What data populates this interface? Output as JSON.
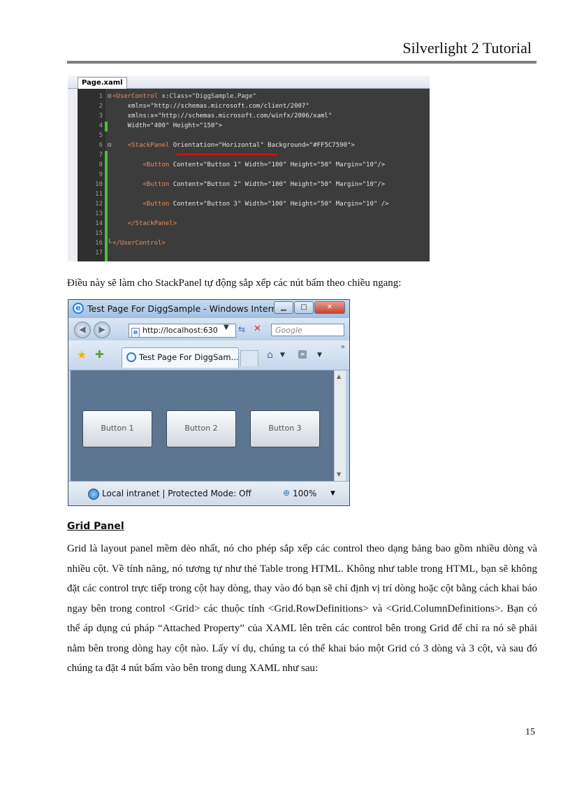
{
  "header": {
    "title": "Silverlight 2 Tutorial"
  },
  "code_editor": {
    "tab_label": "Page.xaml",
    "lines": [
      {
        "num": "1",
        "html": "<span class=\"tag\">&lt;UserControl</span> <span class=\"attr\">x:Class=\"DiggSample.Page\"</span>"
      },
      {
        "num": "2",
        "html": "    xmlns=\"http://schemas.microsoft.com/client/2007\""
      },
      {
        "num": "3",
        "html": "    xmlns:x=\"http://schemas.microsoft.com/winfx/2006/xaml\""
      },
      {
        "num": "4",
        "html": "    Width=\"400\" Height=\"150\"&gt;"
      },
      {
        "num": "5",
        "html": ""
      },
      {
        "num": "6",
        "html": "    <span class=\"tag\">&lt;StackPanel</span> Orientation=\"Horizontal\" Background=\"#FF5C7590\"&gt;"
      },
      {
        "num": "7",
        "html": ""
      },
      {
        "num": "8",
        "html": "        <span class=\"tag\">&lt;Button</span> Content=\"Button 1\" Width=\"100\" Height=\"50\" Margin=\"10\"/&gt;"
      },
      {
        "num": "9",
        "html": ""
      },
      {
        "num": "10",
        "html": "        <span class=\"tag\">&lt;Button</span> Content=\"Button 2\" Width=\"100\" Height=\"50\" Margin=\"10\"/&gt;"
      },
      {
        "num": "11",
        "html": ""
      },
      {
        "num": "12",
        "html": "        <span class=\"tag\">&lt;Button</span> Content=\"Button 3\" Width=\"100\" Height=\"50\" Margin=\"10\" /&gt;"
      },
      {
        "num": "13",
        "html": ""
      },
      {
        "num": "14",
        "html": "    <span class=\"tag\">&lt;/StackPanel&gt;</span>"
      },
      {
        "num": "15",
        "html": ""
      },
      {
        "num": "16",
        "html": "<span class=\"tag\">&lt;/UserControl&gt;</span>"
      },
      {
        "num": "17",
        "html": ""
      }
    ]
  },
  "caption": "Điều này sẽ làm cho StackPanel tự động sắp xếp các nút bấm theo chiều ngang:",
  "browser": {
    "title": "Test Page For DiggSample - Windows Internet Ex...",
    "address": "http://localhost:630",
    "search_placeholder": "Google",
    "tab_label": "Test Page For DiggSam...",
    "buttons": [
      "Button 1",
      "Button 2",
      "Button 3"
    ],
    "status_text": "Local intranet | Protected Mode: Off",
    "zoom": "100%",
    "content_bg": "#5C7590"
  },
  "section": {
    "heading": "Grid Panel",
    "body": "Grid là layout panel mềm dẻo nhất, nó cho phép sắp xếp các control theo dạng bảng bao gồm nhiều dòng và nhiều cột. Về tính năng, nó tương tự như thẻ Table trong HTML. Không như table trong HTML, bạn sẽ không đặt các control trực tiếp trong cột hay dòng, thay vào đó bạn sẽ chỉ định vị trí dòng hoặc cột bằng cách khai báo ngay bên trong control <Grid> các thuộc tính <Grid.RowDefinitions> và <Grid.ColumnDefinitions>. Bạn có thể áp dụng cú pháp “Attached Property” của XAML lên trên các control bên trong Grid để chỉ ra nó sẽ phải nằm bên trong dòng hay cột nào. Lấy ví dụ, chúng ta có thể khai báo một Grid có 3 dòng và 3 cột, và sau đó chúng ta đặt 4 nút bấm vào bên trong dung XAML như sau:"
  },
  "page_number": "15"
}
